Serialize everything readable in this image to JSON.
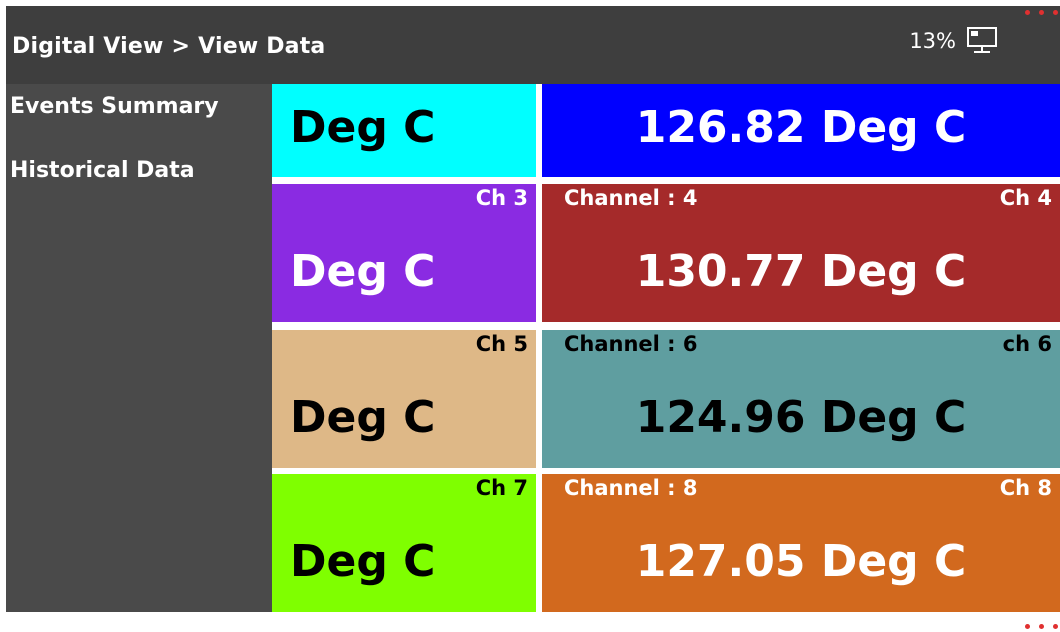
{
  "header": {
    "breadcrumb": [
      "Digital View",
      "View Data"
    ],
    "breadcrumb_sep": ">",
    "battery": "13%",
    "monitor_icon": "monitor-icon",
    "menu_dot_color": "#e03030"
  },
  "sidebar": {
    "items": [
      {
        "label": "Events Summary"
      },
      {
        "label": "Historical Data"
      }
    ]
  },
  "tiles": [
    {
      "name": "",
      "tag": "",
      "value": "Deg C",
      "bg": "#00ffff",
      "fg": "#000000"
    },
    {
      "name": "",
      "tag": "",
      "value": "126.82 Deg C",
      "bg": "#0000ff",
      "fg": "#ffffff"
    },
    {
      "name": "",
      "tag": "Ch 3",
      "value": "Deg C",
      "bg": "#8a2be2",
      "fg": "#ffffff"
    },
    {
      "name": "Channel : 4",
      "tag": "Ch 4",
      "value": "130.77 Deg C",
      "bg": "#a52a2a",
      "fg": "#ffffff"
    },
    {
      "name": "",
      "tag": "Ch 5",
      "value": "Deg C",
      "bg": "#deb887",
      "fg": "#000000"
    },
    {
      "name": "Channel : 6",
      "tag": "ch 6",
      "value": "124.96 Deg C",
      "bg": "#5f9ea0",
      "fg": "#000000"
    },
    {
      "name": "",
      "tag": "Ch 7",
      "value": "Deg C",
      "bg": "#7fff00",
      "fg": "#000000"
    },
    {
      "name": "Channel : 8",
      "tag": "Ch 8",
      "value": "127.05 Deg C",
      "bg": "#d2691e",
      "fg": "#ffffff"
    }
  ]
}
